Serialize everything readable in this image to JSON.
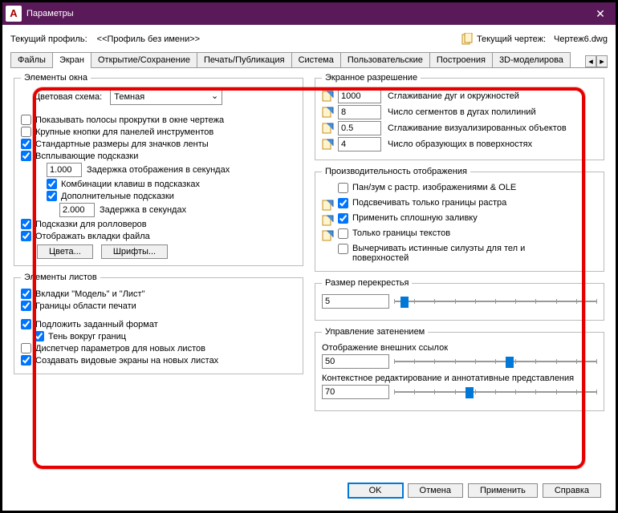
{
  "window": {
    "title": "Параметры"
  },
  "profile": {
    "label": "Текущий профиль:",
    "value": "<<Профиль без имени>>",
    "drawing_label": "Текущий чертеж:",
    "drawing_value": "Чертеж6.dwg"
  },
  "tabs": {
    "items": [
      "Файлы",
      "Экран",
      "Открытие/Сохранение",
      "Печать/Публикация",
      "Система",
      "Пользовательские",
      "Построения",
      "3D-моделирова"
    ],
    "active_index": 1
  },
  "window_elems": {
    "legend": "Элементы окна",
    "color_scheme_label": "Цветовая схема:",
    "color_scheme_value": "Темная",
    "scrollbars": {
      "label": "Показывать полосы прокрутки в окне чертежа",
      "checked": false
    },
    "big_buttons": {
      "label": "Крупные кнопки для панелей инструментов",
      "checked": false
    },
    "std_ribbon": {
      "label": "Стандартные размеры для значков ленты",
      "checked": true
    },
    "tooltips": {
      "label": "Всплывающие подсказки",
      "checked": true
    },
    "tt_delay": {
      "value": "1.000",
      "label": "Задержка отображения в секундах"
    },
    "tt_keys": {
      "label": "Комбинации клавиш в подсказках",
      "checked": true
    },
    "tt_extra": {
      "label": "Дополнительные подсказки",
      "checked": true
    },
    "tt_delay2": {
      "value": "2.000",
      "label": "Задержка в секундах"
    },
    "rollover": {
      "label": "Подсказки для ролловеров",
      "checked": true
    },
    "filetabs": {
      "label": "Отображать вкладки файла",
      "checked": true
    },
    "colors_btn": "Цвета...",
    "fonts_btn": "Шрифты..."
  },
  "layout_elems": {
    "legend": "Элементы листов",
    "model_layout": {
      "label": "Вкладки  \"Модель\" и \"Лист\"",
      "checked": true
    },
    "plot_borders": {
      "label": "Границы области печати",
      "checked": true
    },
    "paper_bg": {
      "label": "Подложить заданный формат",
      "checked": true
    },
    "shadow": {
      "label": "Тень вокруг границ",
      "checked": true
    },
    "pagesetup": {
      "label": "Диспетчер параметров для новых листов",
      "checked": false
    },
    "viewports": {
      "label": "Создавать видовые экраны на новых листах",
      "checked": true
    }
  },
  "resolution": {
    "legend": "Экранное разрешение",
    "arc": {
      "value": "1000",
      "label": "Сглаживание дуг и окружностей"
    },
    "seg": {
      "value": "8",
      "label": "Число сегментов в дугах полилиний"
    },
    "render": {
      "value": "0.5",
      "label": "Сглаживание визуализированных объектов"
    },
    "surf": {
      "value": "4",
      "label": "Число образующих в поверхностях"
    }
  },
  "performance": {
    "legend": "Производительность отображения",
    "panzoom": {
      "label": "Пан/зум с растр. изображениями & OLE",
      "checked": false
    },
    "highlight": {
      "label": "Подсвечивать только границы растра",
      "checked": true
    },
    "solidfill": {
      "label": "Применить сплошную заливку",
      "checked": true
    },
    "textframe": {
      "label": "Только границы текстов",
      "checked": false
    },
    "silhouette": {
      "label": "Вычерчивать истинные силуэты для тел и поверхностей",
      "checked": false
    }
  },
  "crosshair": {
    "legend": "Размер перекрестья",
    "value": "5",
    "pct": 5
  },
  "fade": {
    "legend": "Управление затенением",
    "xref_label": "Отображение внешних ссылок",
    "xref_value": "50",
    "xref_pct": 50,
    "edit_label": "Контекстное редактирование и аннотативные представления",
    "edit_value": "70",
    "edit_pct": 70
  },
  "buttons": {
    "ok": "OK",
    "cancel": "Отмена",
    "apply": "Применить",
    "help": "Справка"
  }
}
